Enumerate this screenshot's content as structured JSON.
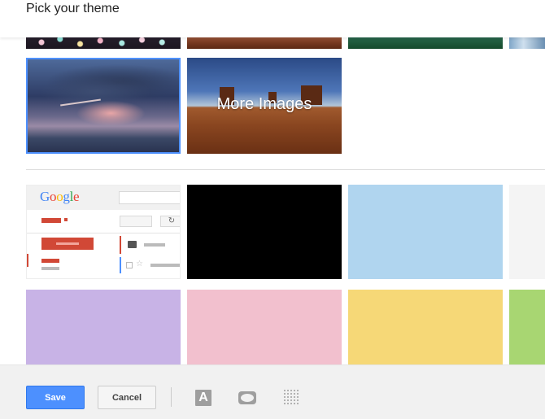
{
  "header": {
    "title": "Pick your theme"
  },
  "image_tiles": {
    "more_images_label": "More Images"
  },
  "preview": {
    "logo_text": "Google",
    "logo_colors": [
      "#4285f4",
      "#ea4335",
      "#fbbc05",
      "#4285f4",
      "#34a853",
      "#ea4335"
    ]
  },
  "color_swatches": {
    "row1": [
      "#000000",
      "#b0d5ef",
      "#f4f4f4"
    ],
    "row2": [
      "#c8b3e6",
      "#f2c0ce",
      "#f6d877",
      "#a8d672"
    ]
  },
  "footer": {
    "save_label": "Save",
    "cancel_label": "Cancel",
    "text_icon_glyph": "A"
  },
  "colors": {
    "accent": "#4d90fe",
    "brand_red": "#d14836"
  }
}
